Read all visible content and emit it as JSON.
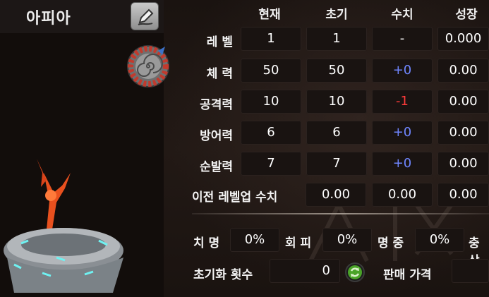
{
  "character": {
    "name": "아피아"
  },
  "icons": {
    "rename": "pencil-icon",
    "emblem": "spiral-emblem-icon",
    "reset": "refresh-icon"
  },
  "stats": {
    "columns": [
      "현재",
      "초기",
      "수치",
      "성장"
    ],
    "rows": [
      {
        "label": "레 벨",
        "current": "1",
        "initial": "1",
        "delta": "-",
        "growth": "0.000"
      },
      {
        "label": "체 력",
        "current": "50",
        "initial": "50",
        "delta": "+0",
        "growth": "0.00"
      },
      {
        "label": "공격력",
        "current": "10",
        "initial": "10",
        "delta": "-1",
        "growth": "0.00"
      },
      {
        "label": "방어력",
        "current": "6",
        "initial": "6",
        "delta": "+0",
        "growth": "0.00"
      },
      {
        "label": "순발력",
        "current": "7",
        "initial": "7",
        "delta": "+0",
        "growth": "0.00"
      }
    ],
    "prev_levelup": {
      "label": "이전 레벨업 수치",
      "values": [
        "0.00",
        "0.00",
        "0.00"
      ]
    }
  },
  "secondary": [
    {
      "label": "치 명",
      "value": "0%"
    },
    {
      "label": "회 피",
      "value": "0%"
    },
    {
      "label": "명 중",
      "value": "0%"
    },
    {
      "label": "충상",
      "value": ""
    }
  ],
  "reset": {
    "label": "초기화 횟수",
    "value": "0"
  },
  "sale": {
    "label": "판매 가격",
    "value": ""
  },
  "colors": {
    "positive": "#6f86ff",
    "negative": "#ff3b3b",
    "background": "#120d0b"
  }
}
